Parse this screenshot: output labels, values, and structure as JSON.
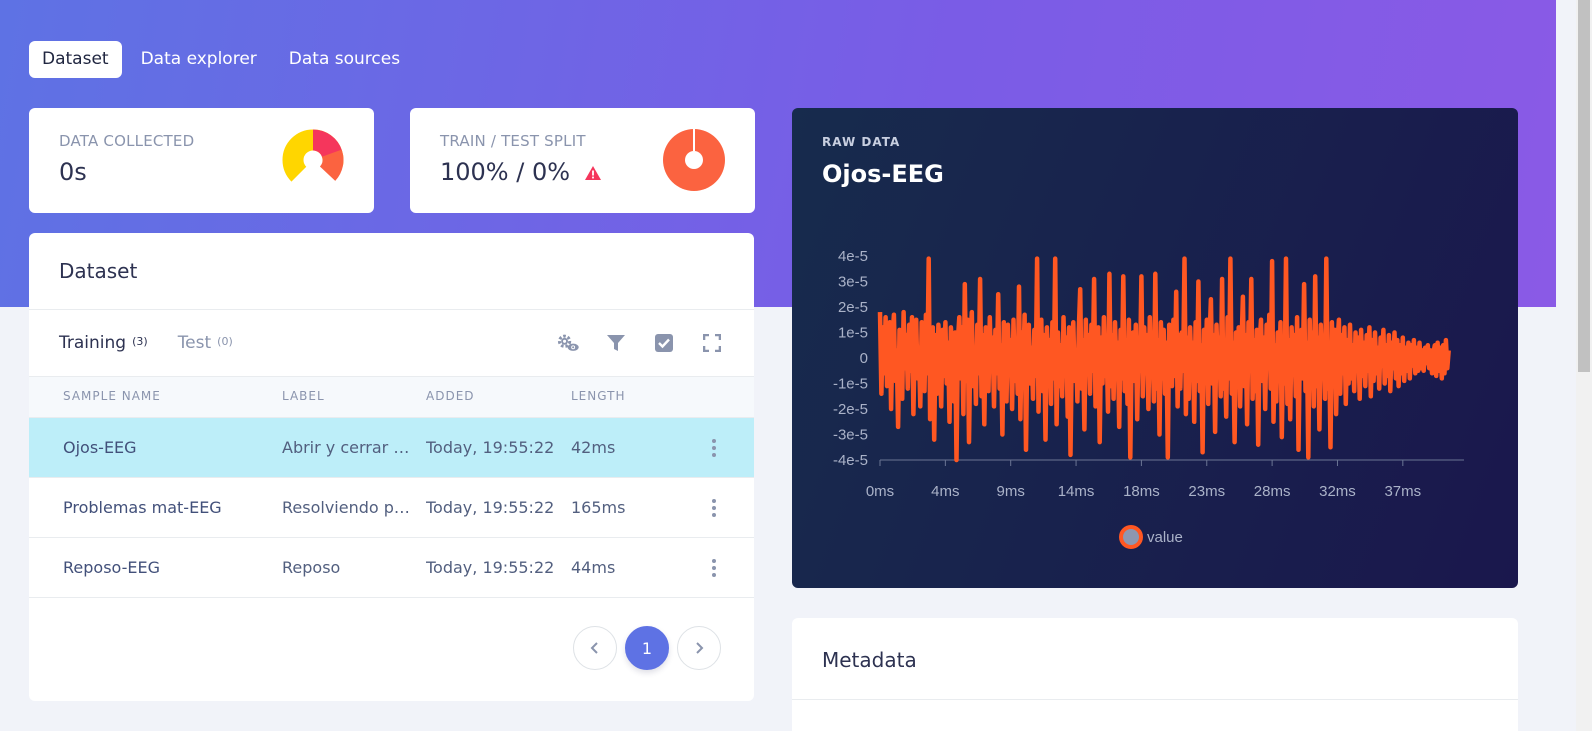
{
  "nav": {
    "tabs": [
      {
        "label": "Dataset",
        "active": true
      },
      {
        "label": "Data explorer",
        "active": false
      },
      {
        "label": "Data sources",
        "active": false
      }
    ]
  },
  "stats": {
    "collected": {
      "label": "DATA COLLECTED",
      "value": "0s"
    },
    "split": {
      "label": "TRAIN / TEST SPLIT",
      "value": "100% / 0%"
    }
  },
  "dataset": {
    "title": "Dataset",
    "subtabs": [
      {
        "label": "Training",
        "count": "(3)"
      },
      {
        "label": "Test",
        "count": "(0)"
      }
    ],
    "columns": [
      "SAMPLE NAME",
      "LABEL",
      "ADDED",
      "LENGTH"
    ],
    "rows": [
      {
        "name": "Ojos-EEG",
        "label": "Abrir y cerrar o...",
        "added": "Today, 19:55:22",
        "length": "42ms",
        "selected": true
      },
      {
        "name": "Problemas mat-EEG",
        "label": "Resolviendo pr...",
        "added": "Today, 19:55:22",
        "length": "165ms",
        "selected": false
      },
      {
        "name": "Reposo-EEG",
        "label": "Reposo",
        "added": "Today, 19:55:22",
        "length": "44ms",
        "selected": false
      }
    ],
    "pagination": {
      "current": "1"
    }
  },
  "raw": {
    "label": "RAW DATA",
    "title": "Ojos-EEG"
  },
  "metadata": {
    "title": "Metadata"
  },
  "colors": {
    "accent": "#5e72e4",
    "series": "#ff5722",
    "warning": "#f5365c",
    "donut_yellow": "#ffd600",
    "donut_red": "#f5365c",
    "donut_orange": "#fb6340"
  },
  "chart_data": {
    "type": "line",
    "title": "",
    "xlabel": "",
    "ylabel": "",
    "x_tick_labels": [
      "0ms",
      "4ms",
      "9ms",
      "14ms",
      "18ms",
      "23ms",
      "28ms",
      "32ms",
      "37ms"
    ],
    "y_tick_labels": [
      "4e-5",
      "3e-5",
      "2e-5",
      "1e-5",
      "0",
      "-1e-5",
      "-2e-5",
      "-3e-5",
      "-4e-5"
    ],
    "ylim": [
      -4e-05,
      4e-05
    ],
    "xlim_ms": [
      0,
      42
    ],
    "legend": "bottom-center",
    "series": [
      {
        "name": "value",
        "x_ms_step": 0.1,
        "values": [
          1.8e-05,
          -1.4e-05,
          1.2e-05,
          -6e-06,
          1.6e-05,
          -1.1e-05,
          5e-06,
          1.4e-05,
          -2e-05,
          8e-06,
          1.7e-05,
          -9e-06,
          3e-06,
          -2.7e-05,
          1.1e-05,
          6e-06,
          -1.6e-05,
          1.8e-05,
          -4e-06,
          9e-06,
          -1.2e-05,
          1.3e-05,
          -5e-06,
          1.6e-05,
          -2.2e-05,
          7e-06,
          1.5e-05,
          -8e-06,
          4e-06,
          -1.9e-05,
          1.4e-05,
          5e-06,
          -1.3e-05,
          1.7e-05,
          -6e-06,
          3.9e-05,
          -2.4e-05,
          8e-06,
          1.2e-05,
          -3.2e-05,
          9e-06,
          -1.4e-05,
          1.3e-05,
          3e-06,
          -1.9e-05,
          1.1e-05,
          -7e-06,
          1.4e-05,
          -1e-05,
          6e-06,
          -2.5e-05,
          1.2e-05,
          4e-06,
          -1.7e-05,
          1e-05,
          -4e-05,
          7e-06,
          1.6e-05,
          -8e-06,
          1.2e-05,
          -2.2e-05,
          2.9e-05,
          -9e-06,
          1.5e-05,
          -3.3e-05,
          6e-06,
          1.8e-05,
          -1.1e-05,
          4e-06,
          -1.8e-05,
          1.3e-05,
          -6e-06,
          3.1e-05,
          -1.5e-05,
          9e-06,
          -2.6e-05,
          1.2e-05,
          3e-06,
          -1.3e-05,
          1.6e-05,
          -5e-06,
          8e-06,
          -1.9e-05,
          1.1e-05,
          -6e-06,
          2.5e-05,
          -1.2e-05,
          5e-06,
          -3e-05,
          1.4e-05,
          2e-06,
          -1.7e-05,
          1.3e-05,
          -4e-06,
          7e-06,
          -2e-05,
          1.5e-05,
          -9e-06,
          6e-06,
          -1.4e-05,
          2.8e-05,
          -2.4e-05,
          1e-05,
          -5e-06,
          1.7e-05,
          -3.6e-05,
          8e-06,
          1.3e-05,
          -1e-05,
          4e-06,
          -1.6e-05,
          1.1e-05,
          -7e-06,
          3.9e-05,
          -2.1e-05,
          6e-06,
          1.5e-05,
          -1.3e-05,
          9e-06,
          -3.2e-05,
          1.2e-05,
          -3e-06,
          7e-06,
          -1.8e-05,
          1.4e-05,
          -8e-06,
          3.9e-05,
          -2.6e-05,
          1e-05,
          -1.1e-05,
          5e-06,
          -1.5e-05,
          1.6e-05,
          -4e-06,
          8e-06,
          -2.3e-05,
          1.2e-05,
          -3.8e-05,
          6e-06,
          1.4e-05,
          -9e-06,
          3e-06,
          -1.7e-05,
          1.1e-05,
          2.7e-05,
          -1.2e-05,
          7e-06,
          -2.8e-05,
          1.5e-05,
          -6e-06,
          9e-06,
          -1.4e-05,
          1.3e-05,
          -5e-06,
          3.1e-05,
          -1.9e-05,
          4e-06,
          1.2e-05,
          -3.3e-05,
          8e-06,
          -1e-05,
          1.6e-05,
          -7e-06,
          5e-06,
          -2.1e-05,
          3.3e-05,
          -1.1e-05,
          9e-06,
          -1.6e-05,
          1.4e-05,
          -4e-06,
          6e-06,
          -2.7e-05,
          1.1e-05,
          -8e-06,
          3.2e-05,
          -1.3e-05,
          7e-06,
          -1.8e-05,
          1.5e-05,
          -3.9e-05,
          4e-06,
          1e-05,
          -9e-06,
          1.3e-05,
          -2.4e-05,
          8e-06,
          -5e-06,
          3.2e-05,
          -1.5e-05,
          1.2e-05,
          -6e-06,
          9e-06,
          -2e-05,
          1.6e-05,
          -3e-06,
          5e-06,
          -1.7e-05,
          3.3e-05,
          -1.2e-05,
          7e-06,
          -3e-05,
          1.4e-05,
          -8e-06,
          1.1e-05,
          -1.4e-05,
          6e-06,
          -3.9e-05,
          1.3e-05,
          2e-06,
          -1.1e-05,
          1.5e-05,
          -7e-06,
          2.6e-05,
          -1.9e-05,
          9e-06,
          -1.2e-05,
          1e-05,
          -5e-06,
          3.9e-05,
          -2.2e-05,
          8e-06,
          -1.6e-05,
          1.2e-05,
          -4e-06,
          6e-06,
          -2.5e-05,
          1.4e-05,
          -9e-06,
          3e-05,
          -1.3e-05,
          5e-06,
          -3.7e-05,
          1.1e-05,
          -6e-06,
          1.5e-05,
          -1.8e-05,
          7e-06,
          2.3e-05,
          -1e-05,
          9e-06,
          -2.9e-05,
          1.3e-05,
          -5e-06,
          8e-06,
          -1.5e-05,
          3.1e-05,
          -1.2e-05,
          4e-06,
          -2.3e-05,
          1.6e-05,
          -8e-06,
          3.9e-05,
          -1.4e-05,
          6e-06,
          -3.3e-05,
          1e-05,
          -7e-06,
          1.2e-05,
          -1.9e-05,
          5e-06,
          2.4e-05,
          -1.1e-05,
          9e-06,
          -2.6e-05,
          1.4e-05,
          -3e-06,
          3.1e-05,
          -1.6e-05,
          7e-06,
          -1.3e-05,
          1.1e-05,
          -3.4e-05,
          6e-06,
          1.5e-05,
          -9e-06,
          8e-06,
          -2e-05,
          1.3e-05,
          -4e-06,
          1.7e-05,
          -1.2e-05,
          3.8e-05,
          -2.5e-05,
          5e-06,
          -1.7e-05,
          1e-05,
          -6e-06,
          1.4e-05,
          -3.1e-05,
          8e-06,
          -1e-05,
          3.9e-05,
          -1.8e-05,
          7e-06,
          -2.4e-05,
          1.2e-05,
          -5e-06,
          9e-06,
          -1.5e-05,
          1.6e-05,
          -3.6e-05,
          4e-06,
          1.1e-05,
          -8e-06,
          2.9e-05,
          -1.3e-05,
          6e-06,
          -3.9e-05,
          1.5e-05,
          -7e-06,
          1e-05,
          -1.9e-05,
          3.2e-05,
          -1.1e-05,
          8e-06,
          -2.8e-05,
          1.3e-05,
          -4e-06,
          7e-06,
          -1.6e-05,
          3.9e-05,
          -1.2e-05,
          5e-06,
          -3.5e-05,
          1.4e-05,
          -9e-06,
          1.1e-05,
          -2.2e-05,
          6e-06,
          1.5e-05,
          -1.4e-05,
          9e-06,
          -6e-06,
          1.2e-05,
          -1.8e-05,
          7e-06,
          -1e-05,
          1.3e-05,
          -8e-06,
          5e-06,
          -1.3e-05,
          1e-05,
          -4e-06,
          8e-06,
          -1.6e-05,
          1.1e-05,
          -7e-06,
          6e-06,
          -1.1e-05,
          9e-06,
          -5e-06,
          1.2e-05,
          -1.5e-05,
          7e-06,
          -9e-06,
          1e-05,
          -6e-06,
          4e-06,
          -1.2e-05,
          8e-06,
          -3e-06,
          1.1e-05,
          -1e-05,
          5e-06,
          -7e-06,
          9e-06,
          -1.3e-05,
          6e-06,
          -4e-06,
          1e-05,
          -8e-06,
          7e-06,
          -1.1e-05,
          5e-06,
          -6e-06,
          8e-06,
          -9e-06,
          4e-06,
          -5e-06,
          6e-06,
          -8e-06,
          5e-06,
          -3e-06,
          7e-06,
          -6e-06,
          4e-06,
          -5e-06,
          6e-06,
          -4e-06,
          3e-06,
          -5e-06,
          4e-06,
          -2e-06,
          5e-06,
          -4e-06,
          3e-06,
          -6e-06,
          2e-06,
          5e-06,
          -7e-06,
          6e-06,
          -5e-06,
          4e-06,
          -8e-06,
          5e-06,
          -6e-06,
          7e-06,
          -4e-06,
          3e-06
        ]
      }
    ]
  }
}
